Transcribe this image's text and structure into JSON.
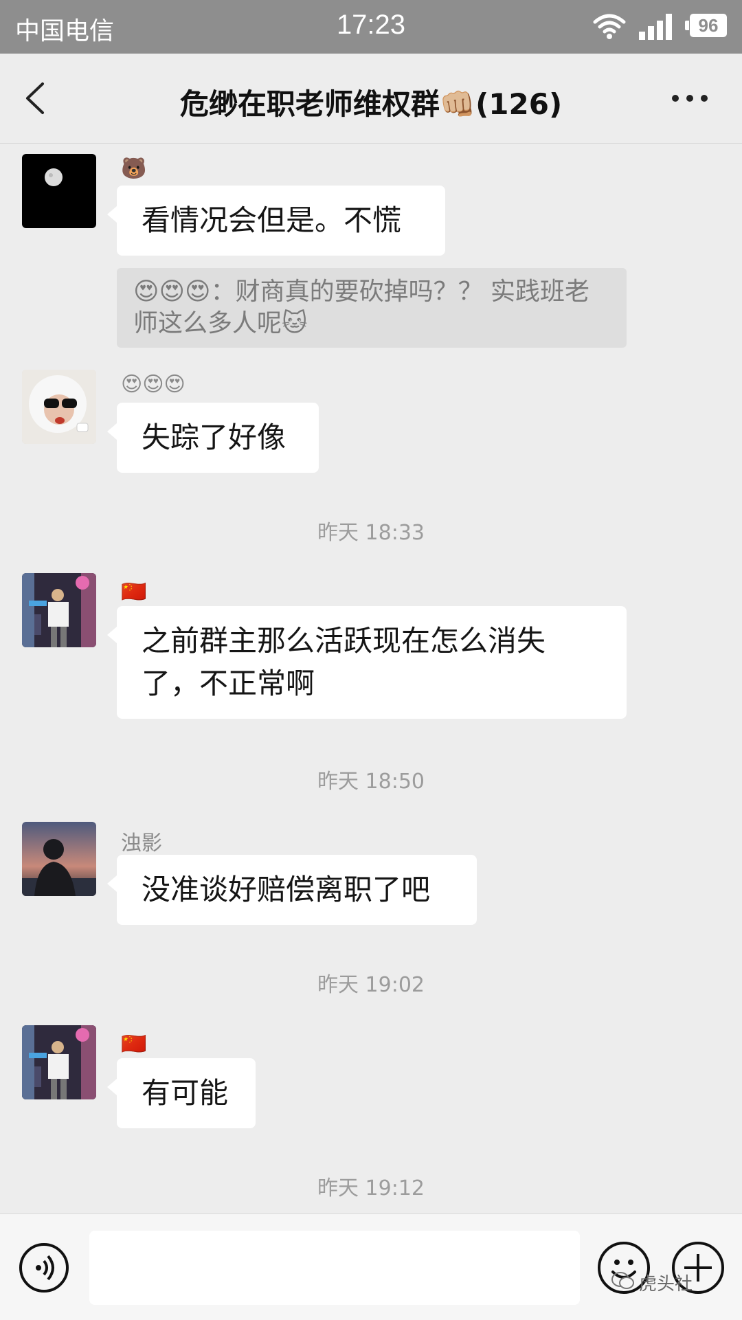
{
  "status_bar": {
    "carrier": "中国电信",
    "time": "17:23",
    "battery": "96"
  },
  "header": {
    "title": "危缈在职老师维权群👊🏼(126)",
    "back_icon": "chevron-left-icon",
    "more_icon": "ellipsis-icon"
  },
  "messages": [
    {
      "sender": "🐻",
      "text": "看情况会但是。不慌",
      "quote": {
        "author": "😍😍😍",
        "text": "财商真的要砍掉吗？？ 实践班老师这么多人呢🐱"
      }
    },
    {
      "sender": "😍😍😍",
      "text": "失踪了好像"
    },
    {
      "sender": "🇨🇳",
      "text": "之前群主那么活跃现在怎么消失了，不正常啊"
    },
    {
      "sender": "浊影",
      "text": "没准谈好赔偿离职了吧"
    },
    {
      "sender": "🇨🇳",
      "text": "有可能"
    }
  ],
  "timestamps": [
    "昨天 18:33",
    "昨天 18:50",
    "昨天 19:02",
    "昨天 19:12"
  ],
  "input": {
    "placeholder": "",
    "voice_icon": "voice-icon",
    "emoji_icon": "emoji-icon",
    "plus_icon": "plus-icon"
  },
  "watermark": "虎头社",
  "colors": {
    "background": "#ededed",
    "bubble": "#ffffff",
    "quote_bg": "#dedede",
    "status_bar": "#8e8e8e"
  }
}
